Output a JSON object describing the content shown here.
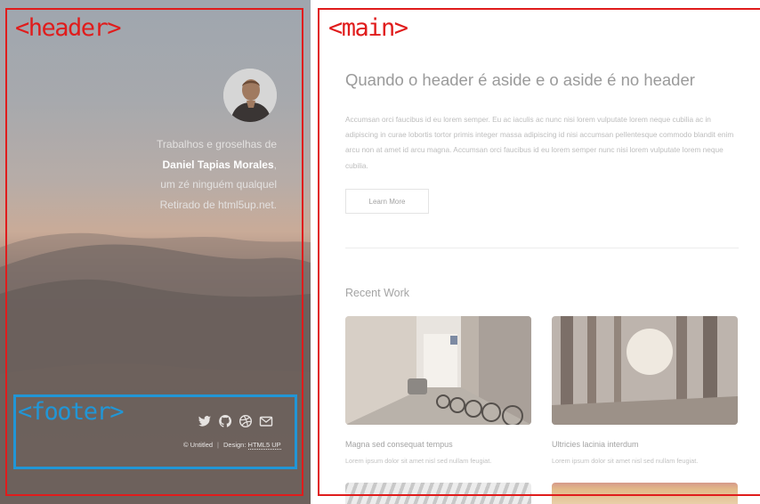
{
  "annotations": {
    "header_tag": "<header>",
    "main_tag": "<main>",
    "footer_tag": "<footer>",
    "colors": {
      "header": "#e01c1c",
      "main": "#e01c1c",
      "footer": "#2196d6"
    }
  },
  "header": {
    "intro_line1": "Trabalhos e groselhas de",
    "name": "Daniel Tapias Morales",
    "name_suffix": ",",
    "intro_line3": "um zé ninguém qualquel",
    "intro_line4": "Retirado de html5up.net.",
    "avatar_icon": "user-avatar"
  },
  "footer": {
    "social_icons": [
      "twitter-icon",
      "github-icon",
      "dribbble-icon",
      "envelope-icon"
    ],
    "copyright": "© Untitled",
    "design_label": "Design:",
    "design_link": "HTML5 UP"
  },
  "main": {
    "title": "Quando o header é aside e o aside é no header",
    "lorem": "Accumsan orci faucibus id eu lorem semper. Eu ac iaculis ac nunc nisi lorem vulputate lorem neque cubilia ac in adipiscing in curae lobortis tortor primis integer massa adipiscing id nisi accumsan pellentesque commodo blandit enim arcu non at amet id arcu magna. Accumsan orci faucibus id eu lorem semper nunc nisi lorem vulputate lorem neque cubilia.",
    "button_label": "Learn More",
    "recent_title": "Recent Work",
    "works": [
      {
        "title": "Magna sed consequat tempus",
        "desc": "Lorem ipsum dolor sit amet nisl sed nullam feugiat."
      },
      {
        "title": "Ultricies lacinia interdum",
        "desc": "Lorem ipsum dolor sit amet nisl sed nullam feugiat."
      }
    ]
  }
}
